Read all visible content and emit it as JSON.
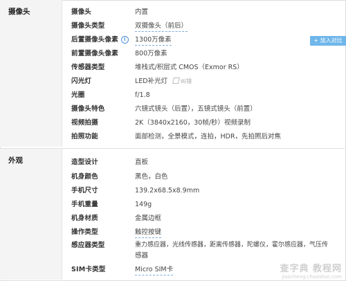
{
  "camera": {
    "title": "摄像头",
    "add_compare": "+ 加入对比",
    "correct_label": "纠错",
    "rows": [
      {
        "k": "摄像头",
        "v": "内置"
      },
      {
        "k": "摄像头类型",
        "v": "双摄像头（前后）"
      },
      {
        "k": "后置摄像头像素",
        "v": "1300万像素"
      },
      {
        "k": "前置摄像头像素",
        "v": "800万像素"
      },
      {
        "k": "传感器类型",
        "v": "堆栈式/积层式 CMOS（Exmor RS）"
      },
      {
        "k": "闪光灯",
        "v": "LED补光灯"
      },
      {
        "k": "光圈",
        "v": "f/1.8"
      },
      {
        "k": "摄像头特色",
        "v": "六镜式镜头（后置），五镜式镜头（前置）"
      },
      {
        "k": "视频拍摄",
        "v": "2K（3840x2160，30帧/秒）视频录制"
      },
      {
        "k": "拍照功能",
        "v": "面部检测，全景模式，连拍，HDR，先拍照后对焦"
      }
    ]
  },
  "appearance": {
    "title": "外观",
    "rows": [
      {
        "k": "造型设计",
        "v": "直板"
      },
      {
        "k": "机身颜色",
        "v": "黑色，白色"
      },
      {
        "k": "手机尺寸",
        "v": "139.2x68.5x8.9mm"
      },
      {
        "k": "手机重量",
        "v": "149g"
      },
      {
        "k": "机身材质",
        "v": "金属边框"
      },
      {
        "k": "操作类型",
        "v": "触控按键"
      },
      {
        "k": "感应器类型",
        "v": "重力感应器，光线传感器，距离传感器，陀螺仪，霍尔感应器，气压传"
      },
      {
        "k": "",
        "v": "感器"
      },
      {
        "k": "SIM卡类型",
        "v": "Micro SIM卡"
      }
    ]
  },
  "watermark": {
    "main": "查字典 教程网",
    "sub": "jiaocheng.chazidian.com"
  }
}
